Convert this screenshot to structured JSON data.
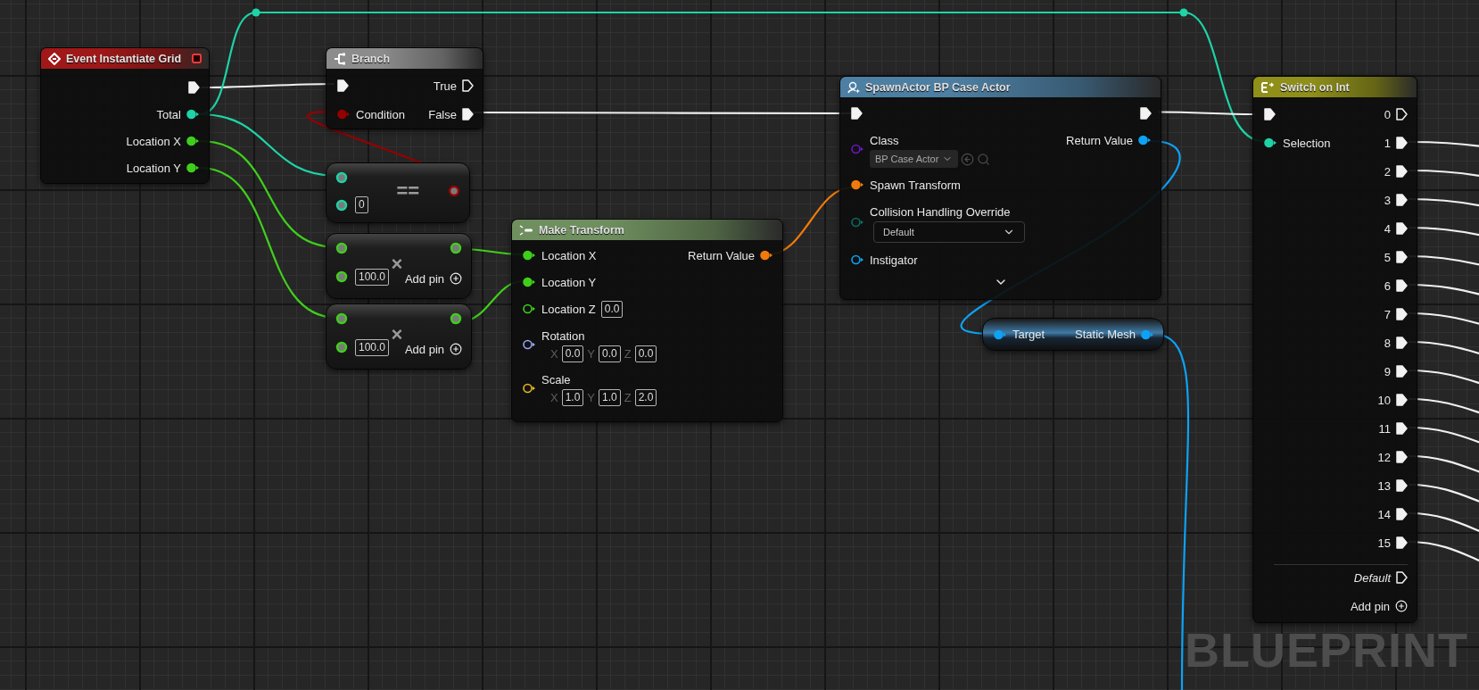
{
  "nodes": [
    {
      "kind": "event",
      "title": "Event Instantiate Grid",
      "color": "#a01818",
      "rows": [
        {
          "right": {
            "kind": "exec",
            "connected": true
          }
        },
        {
          "right": {
            "kind": "data",
            "label": "Total",
            "color": "#1ed3a6",
            "connected": true
          }
        },
        {
          "right": {
            "kind": "data",
            "label": "Location X",
            "color": "#3fcf1b",
            "connected": true
          }
        },
        {
          "right": {
            "kind": "data",
            "label": "Location Y",
            "color": "#3fcf1b",
            "connected": true
          }
        }
      ]
    },
    {
      "kind": "function",
      "title": "Branch",
      "color": "#8c8c8c",
      "rows": [
        {
          "left": {
            "kind": "exec",
            "connected": true
          },
          "right": {
            "kind": "exec",
            "label": "True",
            "connected": false
          }
        },
        {
          "left": {
            "kind": "data",
            "label": "Condition",
            "color": "#950000",
            "connected": true
          },
          "right": {
            "kind": "exec",
            "label": "False",
            "connected": true
          }
        }
      ]
    },
    {
      "kind": "compact",
      "symbol": "==",
      "inputs": [
        {
          "color": "#1ed3a6"
        },
        {
          "color": "#1ed3a6",
          "value": "0"
        }
      ],
      "output": {
        "color": "#950000"
      }
    },
    {
      "kind": "compact",
      "symbol": "×",
      "inputs": [
        {
          "color": "#3fcf1b"
        },
        {
          "color": "#3fcf1b",
          "value": "100.0"
        }
      ],
      "output": {
        "color": "#3fcf1b"
      },
      "add_pin": "Add pin"
    },
    {
      "kind": "compact",
      "symbol": "×",
      "inputs": [
        {
          "color": "#3fcf1b"
        },
        {
          "color": "#3fcf1b",
          "value": "100.0"
        }
      ],
      "output": {
        "color": "#3fcf1b"
      },
      "add_pin": "Add pin"
    },
    {
      "kind": "function",
      "title": "Make Transform",
      "color": "#6f8f5f",
      "rows": [
        {
          "left": {
            "kind": "data",
            "label": "Location X",
            "color": "#3fcf1b",
            "connected": true
          },
          "right": {
            "kind": "data",
            "label": "Return Value",
            "color": "#f07a0c",
            "connected": true
          }
        },
        {
          "left": {
            "kind": "data",
            "label": "Location Y",
            "color": "#3fcf1b",
            "connected": true
          }
        },
        {
          "left": {
            "kind": "data",
            "label": "Location Z",
            "color": "#3fcf1b",
            "connected": false,
            "value": "0.0"
          }
        },
        {
          "left": {
            "kind": "data",
            "label": "Rotation",
            "color": "#9aa7f2",
            "connected": false,
            "fields": [
              {
                "axis": "X",
                "value": "0.0"
              },
              {
                "axis": "Y",
                "value": "0.0"
              },
              {
                "axis": "Z",
                "value": "0.0"
              }
            ]
          }
        },
        {
          "left": {
            "kind": "data",
            "label": "Scale",
            "color": "#e9b91b",
            "connected": false,
            "fields": [
              {
                "axis": "X",
                "value": "1.0"
              },
              {
                "axis": "Y",
                "value": "1.0"
              },
              {
                "axis": "Z",
                "value": "2.0"
              }
            ]
          }
        }
      ]
    },
    {
      "kind": "function",
      "title": "SpawnActor BP Case Actor",
      "color": "#4d7fa3",
      "advanced_expanded": false,
      "rows": [
        {
          "left": {
            "kind": "exec",
            "connected": true
          },
          "right": {
            "kind": "exec",
            "connected": true
          }
        },
        {
          "left": {
            "kind": "data",
            "label": "Class",
            "color": "#6a17c2",
            "connected": false,
            "select": {
              "kind": "asset",
              "value": "BP Case Actor"
            }
          },
          "right": {
            "kind": "data",
            "label": "Return Value",
            "color": "#0ea2f5",
            "connected": true
          }
        },
        {
          "left": {
            "kind": "data",
            "label": "Spawn Transform",
            "color": "#f07a0c",
            "connected": true
          }
        },
        {
          "left": {
            "kind": "data",
            "label": "Collision Handling Override",
            "color": "#0c6b5f",
            "connected": false,
            "select": {
              "kind": "enum",
              "value": "Default"
            }
          }
        },
        {
          "left": {
            "kind": "data",
            "label": "Instigator",
            "color": "#0ea2f5",
            "connected": false
          }
        }
      ]
    },
    {
      "kind": "pure",
      "color": "#3f7aa6",
      "rows": [
        {
          "left": {
            "kind": "data",
            "label": "Target",
            "color": "#0ea2f5",
            "connected": true
          },
          "right": {
            "kind": "data",
            "label": "Static Mesh",
            "color": "#0ea2f5",
            "connected": true
          }
        }
      ]
    },
    {
      "kind": "function",
      "title": "Switch on Int",
      "color": "#8f8f1a",
      "default_pin": {
        "label": "Default",
        "connected": false
      },
      "add_pin": "Add pin",
      "rows": [
        {
          "left": {
            "kind": "exec",
            "connected": true
          },
          "right": {
            "kind": "exec",
            "label": "0",
            "connected": false
          }
        },
        {
          "left": {
            "kind": "data",
            "label": "Selection",
            "color": "#1ed3a6",
            "connected": true
          },
          "right": {
            "kind": "exec",
            "label": "1",
            "connected": true
          }
        },
        {
          "right": {
            "kind": "exec",
            "label": "2",
            "connected": true
          }
        },
        {
          "right": {
            "kind": "exec",
            "label": "3",
            "connected": true
          }
        },
        {
          "right": {
            "kind": "exec",
            "label": "4",
            "connected": true
          }
        },
        {
          "right": {
            "kind": "exec",
            "label": "5",
            "connected": true
          }
        },
        {
          "right": {
            "kind": "exec",
            "label": "6",
            "connected": true
          }
        },
        {
          "right": {
            "kind": "exec",
            "label": "7",
            "connected": true
          }
        },
        {
          "right": {
            "kind": "exec",
            "label": "8",
            "connected": true
          }
        },
        {
          "right": {
            "kind": "exec",
            "label": "9",
            "connected": true
          }
        },
        {
          "right": {
            "kind": "exec",
            "label": "10",
            "connected": true
          }
        },
        {
          "right": {
            "kind": "exec",
            "label": "11",
            "connected": true
          }
        },
        {
          "right": {
            "kind": "exec",
            "label": "12",
            "connected": true
          }
        },
        {
          "right": {
            "kind": "exec",
            "label": "13",
            "connected": true
          }
        },
        {
          "right": {
            "kind": "exec",
            "label": "14",
            "connected": true
          }
        },
        {
          "right": {
            "kind": "exec",
            "label": "15",
            "connected": true
          }
        }
      ]
    }
  ],
  "wires": [
    {
      "color": "#f0f0f0"
    },
    {
      "color": "#1ed3a6"
    },
    {
      "color": "#1ed3a6"
    },
    {
      "color": "#3fcf1b"
    },
    {
      "color": "#3fcf1b"
    },
    {
      "color": "#950000"
    },
    {
      "color": "#3fcf1b"
    },
    {
      "color": "#3fcf1b"
    },
    {
      "color": "#f07a0c"
    },
    {
      "color": "#f0f0f0"
    },
    {
      "color": "#f0f0f0"
    },
    {
      "color": "#0ea2f5"
    },
    {
      "color": "#0ea2f5"
    },
    {
      "color": "#f0f0f0"
    },
    {
      "color": "#f0f0f0"
    },
    {
      "color": "#f0f0f0"
    },
    {
      "color": "#f0f0f0"
    },
    {
      "color": "#f0f0f0"
    },
    {
      "color": "#f0f0f0"
    },
    {
      "color": "#f0f0f0"
    },
    {
      "color": "#f0f0f0"
    },
    {
      "color": "#f0f0f0"
    },
    {
      "color": "#f0f0f0"
    },
    {
      "color": "#f0f0f0"
    },
    {
      "color": "#f0f0f0"
    },
    {
      "color": "#f0f0f0"
    },
    {
      "color": "#f0f0f0"
    },
    {
      "color": "#f0f0f0"
    }
  ],
  "graph_label": "BLUEPRINT"
}
